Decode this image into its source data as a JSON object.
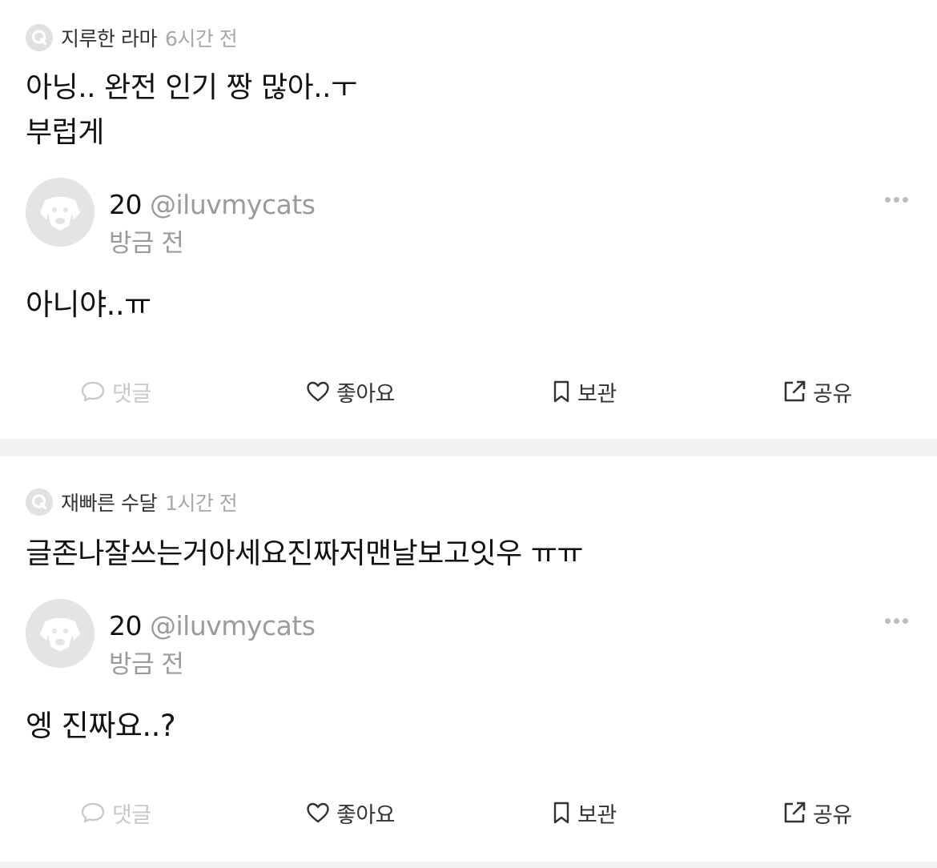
{
  "posts": [
    {
      "question": {
        "author": "지루한 라마",
        "time": "6시간 전",
        "text": "아닝.. 완전 인기 짱 많아..ㅜ\n부럽게"
      },
      "answer": {
        "age": "20",
        "handle": "@iluvmycats",
        "time": "방금 전",
        "text": "아니야..ㅠ"
      },
      "actions": {
        "comment": "댓글",
        "like": "좋아요",
        "save": "보관",
        "share": "공유"
      }
    },
    {
      "question": {
        "author": "재빠른 수달",
        "time": "1시간 전",
        "text": "글존나잘쓰는거아세요진짜저맨날보고잇우 ㅠㅠ"
      },
      "answer": {
        "age": "20",
        "handle": "@iluvmycats",
        "time": "방금 전",
        "text": "엥 진짜요..?"
      },
      "actions": {
        "comment": "댓글",
        "like": "좋아요",
        "save": "보관",
        "share": "공유"
      }
    }
  ],
  "colors": {
    "text": "#111111",
    "muted": "#9b9b9b",
    "disabled": "#c8c8c8",
    "badge": "#e1e1e1",
    "divider": "#f2f2f2"
  },
  "icons": {
    "question_badge": "q-badge-icon",
    "avatar": "dog-avatar-icon",
    "more": "more-dots-icon",
    "comment": "speech-bubble-icon",
    "like": "heart-icon",
    "save": "bookmark-icon",
    "share": "share-icon"
  }
}
